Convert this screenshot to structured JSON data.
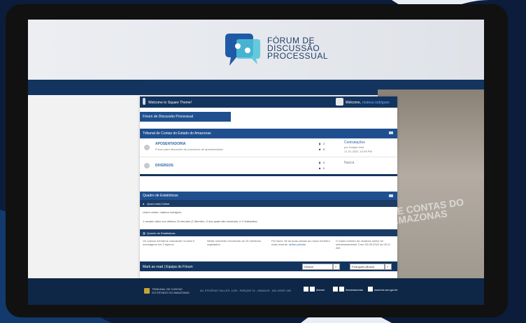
{
  "window": {
    "logo_line1": "FÓRUM DE",
    "logo_line2": "DISCUSSÃO",
    "logo_line3": "PROCESSUAL"
  },
  "topbar": {
    "welcome_left": "Welcome to Square Theme!",
    "welcome_right_prefix": "Welcome, ",
    "user": "mateus.rodrigues"
  },
  "breadcrumb": {
    "label": "Fórum de Discussão Processual"
  },
  "category": {
    "title": "Tribunal de Contas do Estado do Amazonas"
  },
  "forums": [
    {
      "title": "APOSENTADORIA",
      "desc": "Fórum para discussão de processos de aposentadoria.",
      "topics": "2",
      "posts": "5",
      "last_title": "Contratações",
      "last_by": "por Kaiapa Ieira",
      "last_time": "17-01-2022, 10:59 PM"
    },
    {
      "title": "DIVERSOS",
      "desc": "",
      "topics": "0",
      "posts": "0",
      "last_title": "Nunca",
      "last_by": "",
      "last_time": ""
    }
  ],
  "stats": {
    "title": "Quadro de Estatísticas",
    "online_heading": "Quem está Online",
    "online_user": "Users online: mateus.rodrigues",
    "online_line": "1 usuário ativo nos últimos 15 minutos (1 Membro, 0 dos quais são invisíveis, e 0 Visitantes).",
    "stats_heading": "Quadro de Estatísticas",
    "col1": "Os nossos membros colocaram no total 5 mensagens em 2 tópicos.",
    "col2": "Neste momento encontram-se 15 membros registados.",
    "col3_prefix": "Por favor, dê as boas-vindas ao nosso membro mais recente, ",
    "col3_user": "arthur.peixoto",
    "col4": "O maior número de usuários online foi simultaneamente 3 em 03-05-2022 às 09:11 AM."
  },
  "bottom": {
    "mark_read": "Mark as read | Equipa do Fórum",
    "theme_select": "Default",
    "lang_select": "Português (Brasil)",
    "go_label": "»"
  },
  "footer": {
    "org_line1": "TRIBUNAL DE CONTAS",
    "org_line2": "DO ESTADO DO AMAZONAS",
    "address": "AV. EFIGÊNIO SALLES, 1155 - PARQUE 10 - MANAUS - AM, 69057-050",
    "social1": "/tceam",
    "social2": "/tceamazonas",
    "site": "www.tce.am.gov.br"
  },
  "colors": {
    "primary": "#13345e",
    "accent": "#2c64a8",
    "link": "#2c64a8"
  }
}
